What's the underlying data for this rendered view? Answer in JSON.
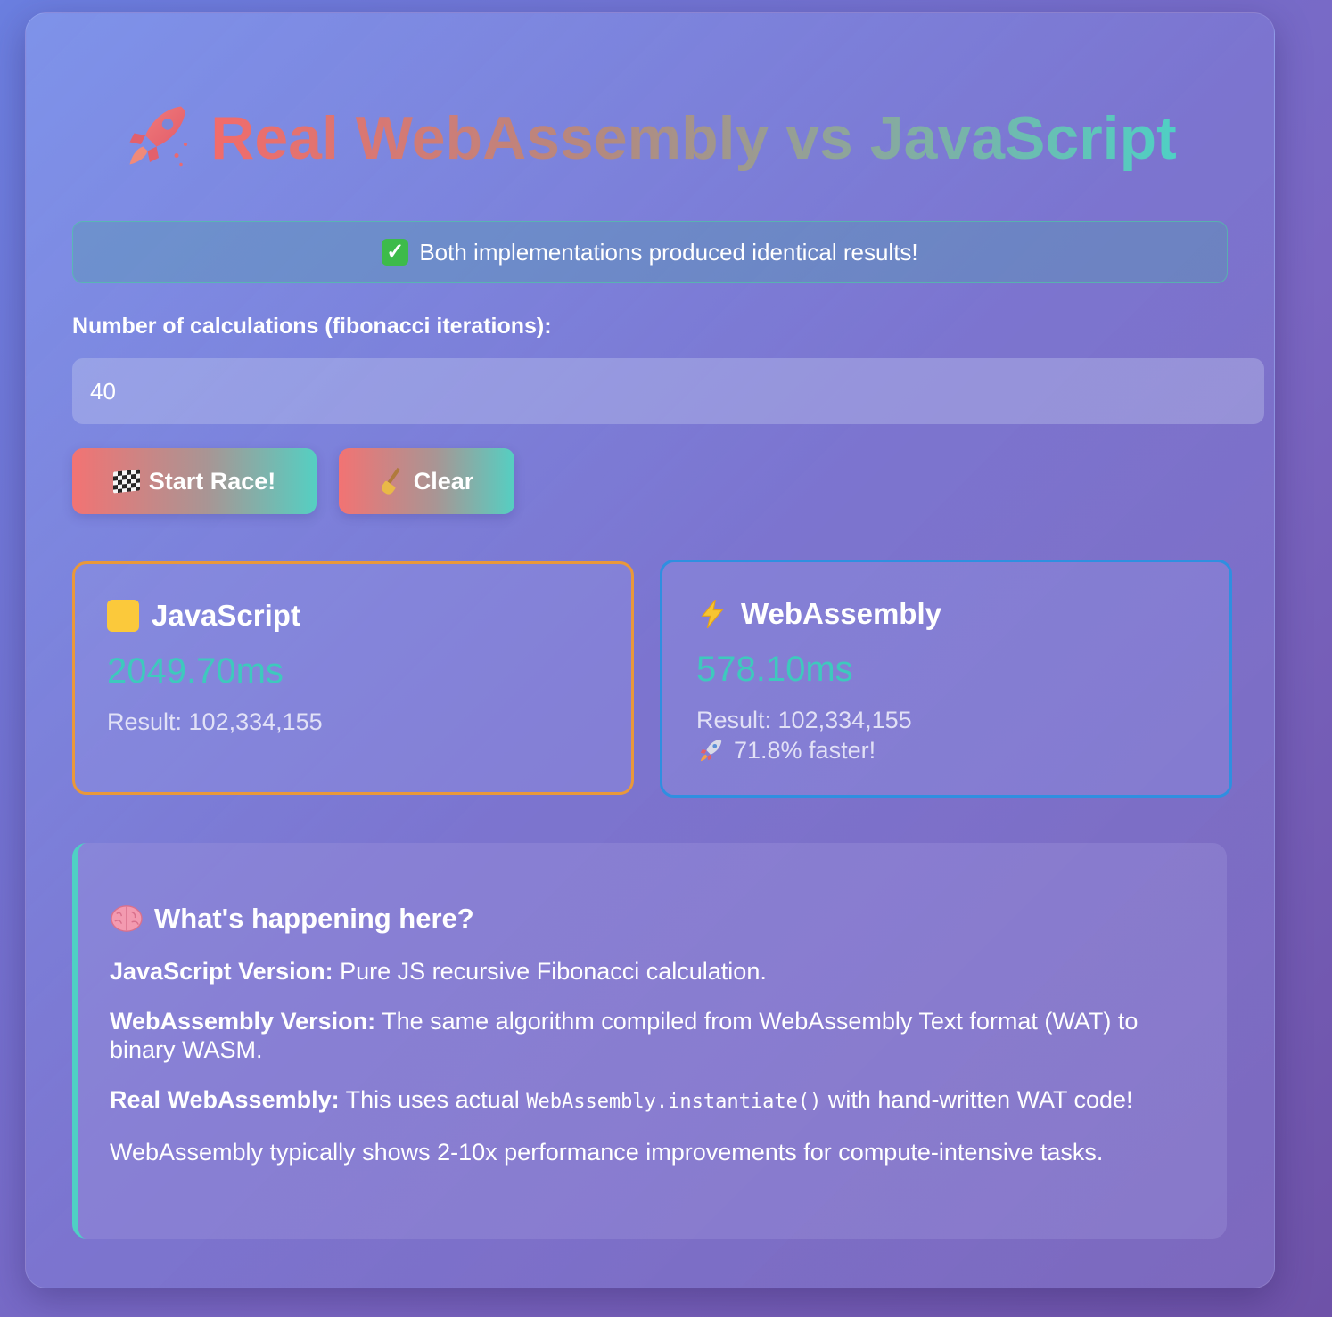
{
  "header": {
    "title": "Real WebAssembly vs JavaScript",
    "title_icon": "rocket-icon"
  },
  "status": {
    "message": "Both implementations produced identical results!",
    "icon": "check-mark-icon",
    "color": "#3dbb4a"
  },
  "form": {
    "label": "Number of calculations (fibonacci iterations):",
    "value": "40"
  },
  "buttons": {
    "start_label": "Start Race!",
    "start_icon": "checkered-flag-icon",
    "clear_label": "Clear",
    "clear_icon": "broom-icon"
  },
  "results": {
    "javascript": {
      "title": "JavaScript",
      "icon": "yellow-square-icon",
      "time": "2049.70ms",
      "result": "Result: 102,334,155",
      "border_color": "#e9983a"
    },
    "webassembly": {
      "title": "WebAssembly",
      "icon": "lightning-icon",
      "time": "578.10ms",
      "result": "Result: 102,334,155",
      "faster": "71.8% faster!",
      "border_color": "#2f8fe0"
    }
  },
  "info": {
    "heading": "What's happening here?",
    "heading_icon": "brain-icon",
    "js_label": "JavaScript Version:",
    "js_text": " Pure JS recursive Fibonacci calculation.",
    "wasm_label": "WebAssembly Version:",
    "wasm_text": " The same algorithm compiled from WebAssembly Text format (WAT) to binary WASM.",
    "real_label": "Real WebAssembly:",
    "real_text_before": " This uses actual ",
    "real_code": "WebAssembly.instantiate()",
    "real_text_after": " with hand-written WAT code!",
    "note": "WebAssembly typically shows 2-10x performance improvements for compute-intensive tasks."
  },
  "colors": {
    "accent_teal": "#3ec9bd",
    "gradient_start": "#f27373",
    "gradient_end": "#55cfc2"
  }
}
